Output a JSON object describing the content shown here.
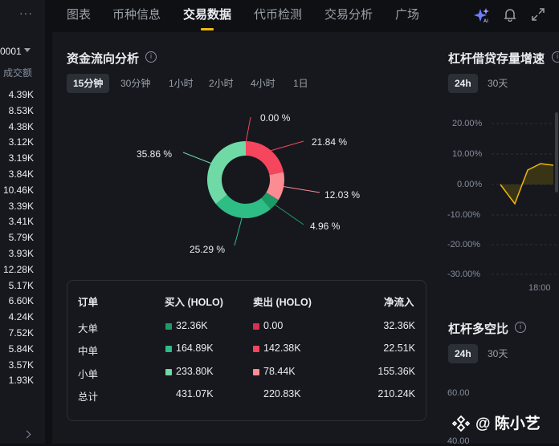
{
  "nav": {
    "tabs": [
      {
        "label": "图表"
      },
      {
        "label": "币种信息"
      },
      {
        "label": "交易数据"
      },
      {
        "label": "代币检测"
      },
      {
        "label": "交易分析"
      },
      {
        "label": "广场"
      }
    ],
    "active_tab": "交易数据"
  },
  "left": {
    "more": "···",
    "precision": "0001",
    "col_header": "成交额",
    "volumes": [
      "4.39K",
      "8.53K",
      "4.38K",
      "3.12K",
      "3.19K",
      "3.84K",
      "10.46K",
      "3.39K",
      "3.41K",
      "5.79K",
      "3.93K",
      "12.28K",
      "5.17K",
      "6.60K",
      "4.24K",
      "7.52K",
      "5.84K",
      "3.57K",
      "1.93K"
    ]
  },
  "fund_flow": {
    "title": "资金流向分析",
    "info": "i",
    "intervals": [
      "15分钟",
      "30分钟",
      "1小时",
      "2小时",
      "4小时",
      "1日"
    ],
    "active_interval": "15分钟",
    "donut_labels": {
      "big_sell": "0.00 %",
      "mid_sell": "21.84 %",
      "small_sell": "12.03 %",
      "big_buy": "4.96 %",
      "mid_buy": "25.29 %",
      "small_buy": "35.86 %"
    }
  },
  "chart_data": {
    "type": "pie",
    "title": "",
    "slices": [
      {
        "label": "0.00 %",
        "value": 0.0,
        "color": "#f6465d"
      },
      {
        "label": "21.84 %",
        "value": 21.84,
        "color": "#f6465d"
      },
      {
        "label": "12.03 %",
        "value": 12.03,
        "color": "#fb8c94"
      },
      {
        "label": "4.96 %",
        "value": 4.96,
        "color": "#1c9b66"
      },
      {
        "label": "25.29 %",
        "value": 25.29,
        "color": "#2ebd85"
      },
      {
        "label": "35.86 %",
        "value": 35.86,
        "color": "#6fdaa6"
      }
    ]
  },
  "table": {
    "headers": {
      "order": "订单",
      "buy": "买入 (HOLO)",
      "sell": "卖出 (HOLO)",
      "net": "净流入"
    },
    "rows": [
      {
        "label": "大单",
        "buy": "32.36K",
        "sell": "0.00",
        "net": "32.36K",
        "buy_color": "#1c9b66",
        "sell_color": "#d9304e"
      },
      {
        "label": "中单",
        "buy": "164.89K",
        "sell": "142.38K",
        "net": "22.51K",
        "buy_color": "#2ebd85",
        "sell_color": "#f6465d"
      },
      {
        "label": "小单",
        "buy": "233.80K",
        "sell": "78.44K",
        "net": "155.36K",
        "buy_color": "#6fdaa6",
        "sell_color": "#fb8c94"
      },
      {
        "label": "总计",
        "buy": "431.07K",
        "sell": "220.83K",
        "net": "210.24K"
      }
    ]
  },
  "leverage": {
    "title": "杠杆借贷存量增速",
    "info": "i",
    "intervals": [
      "24h",
      "30天"
    ],
    "active_interval": "24h",
    "y_ticks": [
      "20.00%",
      "10.00%",
      "0.00%",
      "-10.00%",
      "-20.00%",
      "-30.00%"
    ],
    "x_tick": "18:00",
    "line_color": "#f0b90b"
  },
  "long_short": {
    "title": "杠杆多空比",
    "info": "i",
    "intervals": [
      "24h",
      "30天"
    ],
    "active_interval": "24h",
    "y_ticks": [
      "60.00",
      "40.00"
    ]
  },
  "header_icons": [
    "ai-sparkle-icon",
    "bell-icon",
    "expand-icon"
  ],
  "watermark": {
    "text": "@ 陈小艺"
  }
}
